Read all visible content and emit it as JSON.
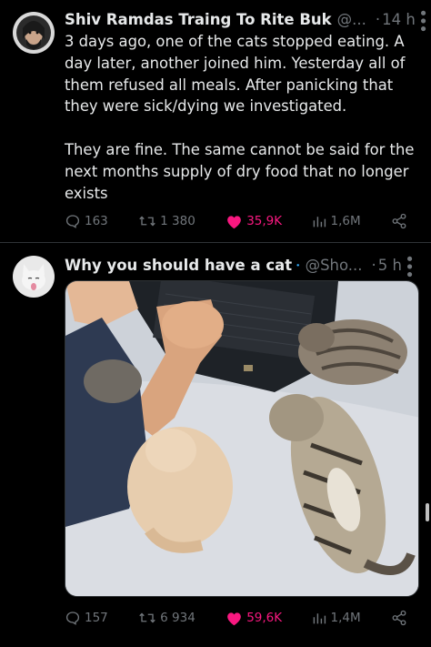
{
  "tweets": [
    {
      "author_name": "Shiv Ramdas Traing To Rite Buk",
      "handle": "@...",
      "time": "14 h",
      "dot": "·",
      "body": [
        "3 days ago, one of the cats stopped eating. A day later, another joined him. Yesterday all of them refused all meals. After panicking that they were sick/dying we investigated.",
        "They are fine. The same cannot be said for the next months supply of dry food that no longer exists"
      ],
      "stats": {
        "replies": "163",
        "reposts": "1 380",
        "likes": "35,9K",
        "views": "1,6M"
      },
      "verified": false
    },
    {
      "author_name": "Why you should have a cat",
      "handle": "@Sho...",
      "time": "5 h",
      "dot": "·",
      "stats": {
        "replies": "157",
        "reposts": "6 934",
        "likes": "59,6K",
        "views": "1,4M"
      },
      "verified": true,
      "media_description_icon": "cats-on-bed-photo"
    }
  ],
  "colors": {
    "background": "#000000",
    "text": "#e7e9ea",
    "muted": "#71767b",
    "like": "#f91880",
    "verified": "#1d9bf0",
    "divider": "#2f3336"
  },
  "icons": [
    "reply-icon",
    "repost-icon",
    "heart-icon",
    "views-icon",
    "share-icon",
    "more-icon",
    "verified-badge-icon"
  ]
}
